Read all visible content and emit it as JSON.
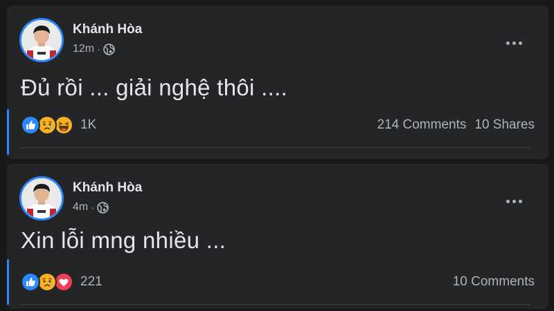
{
  "posts": [
    {
      "author": "Khánh Hòa",
      "time": "12m",
      "audience_icon": "globe-icon",
      "text": "Đủ rồi ... giải nghệ thôi ....",
      "reactions": [
        "like-icon",
        "sad-icon",
        "haha-icon"
      ],
      "reaction_count": "1K",
      "comments": "214 Comments",
      "shares": "10 Shares"
    },
    {
      "author": "Khánh Hòa",
      "time": "4m",
      "audience_icon": "globe-icon",
      "text": "Xin lỗi mng nhiều ...",
      "reactions": [
        "like-icon",
        "sad-icon",
        "love-icon"
      ],
      "reaction_count": "221",
      "comments": "10 Comments"
    }
  ],
  "colors": {
    "background": "#18191a",
    "card": "#242526",
    "accent": "#2d88ff",
    "primary_text": "#e4e6eb",
    "secondary_text": "#b0b3b8"
  }
}
